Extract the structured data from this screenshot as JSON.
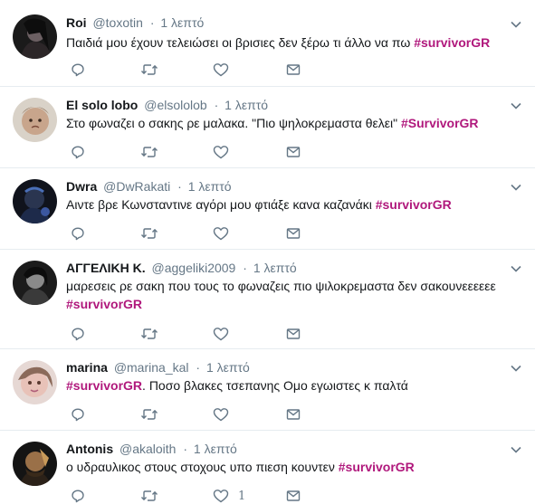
{
  "tweets": [
    {
      "name": "Roi",
      "handle": "@toxotin",
      "time": "1 λεπτό",
      "text": "Παιδιά μου έχουν τελειώσει οι βρισιες δεν ξέρω τι άλλο να πω ",
      "hashtag": "#survivorGR",
      "like_count": ""
    },
    {
      "name": "El solo lobo",
      "handle": "@elsololob",
      "time": "1 λεπτό",
      "text": "Στο φωναζει ο σακης ρε μαλακα. \"Πιο ψηλοκρεμαστα θελει\" ",
      "hashtag": "#SurvivorGR",
      "like_count": ""
    },
    {
      "name": "Dwra",
      "handle": "@DwRakati",
      "time": "1 λεπτό",
      "text": "Αιντε βρε Κωνσταντινε αγόρι μου φτιάξε κανα καζανάκι ",
      "hashtag": "#survivorGR",
      "like_count": ""
    },
    {
      "name": "ΑΓΓΕΛΙΚΗ Κ.",
      "handle": "@aggeliki2009",
      "time": "1 λεπτό",
      "text": "μαρεσεις ρε σακη που τους το φωναζεις πιο ψιλοκρεμαστα δεν σακουνεεεεεε ",
      "hashtag": "#survivorGR",
      "like_count": ""
    },
    {
      "name": "marina",
      "handle": "@marina_kal",
      "time": "1 λεπτό",
      "text": ". Ποσο βλακες τσεπανης Ομο εγωιστες κ παλτά",
      "hashtag": "#survivorGR",
      "like_count": ""
    },
    {
      "name": "Antonis",
      "handle": "@akaloith",
      "time": "1 λεπτό",
      "text": "ο υδραυλικος στους στοχους υπο πιεση κουντεν ",
      "hashtag": "#survivorGR",
      "like_count": "1"
    }
  ],
  "dot": "·",
  "colors": {
    "hashtag": "#b0187c",
    "secondary_text": "#657786",
    "icon": "#657786",
    "divider": "#e6ecf0"
  },
  "icons": [
    "chevron-down-icon",
    "reply-icon",
    "retweet-icon",
    "like-icon",
    "direct-message-icon"
  ]
}
